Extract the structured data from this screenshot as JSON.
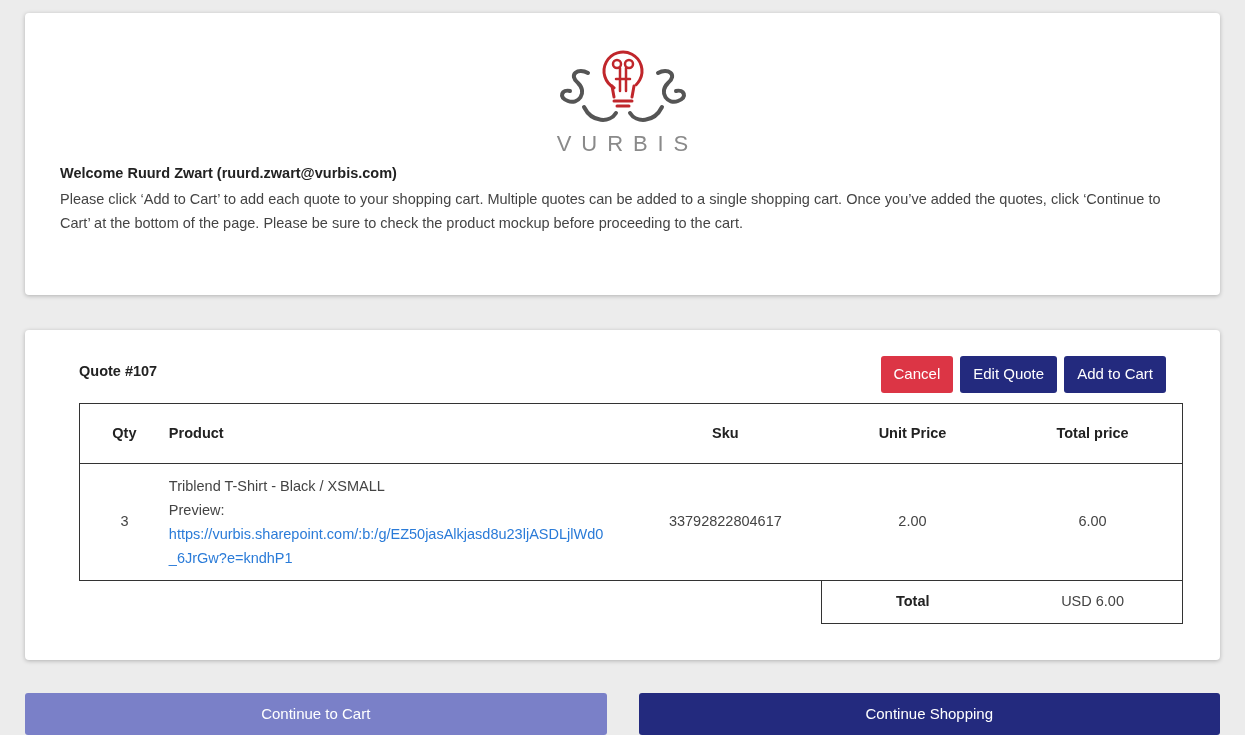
{
  "header": {
    "logo_text": "VURBIS",
    "welcome": "Welcome Ruurd Zwart (ruurd.zwart@vurbis.com)",
    "instructions": "Please click ‘Add to Cart’ to add each quote to your shopping cart. Multiple quotes can be added to a single shopping cart. Once you’ve added the quotes, click ‘Continue to Cart’ at the bottom of the page. Please be sure to check the product mockup before proceeding to the cart."
  },
  "quote": {
    "title": "Quote #107",
    "actions": [
      {
        "label": "Cancel",
        "kind": "danger"
      },
      {
        "label": "Edit Quote",
        "kind": "primary"
      },
      {
        "label": "Add to Cart",
        "kind": "primary"
      }
    ],
    "table": {
      "columns": [
        "Qty",
        "Product",
        "Sku",
        "Unit Price",
        "Total price"
      ],
      "rows": [
        {
          "qty": "3",
          "product": "Triblend T-Shirt - Black / XSMALL",
          "preview_label": "Preview:",
          "preview_link": "https://vurbis.sharepoint.com/:b:/g/EZ50jasAlkjasd8u23ljASDLjlWd0_6JrGw?e=kndhP1",
          "sku": "33792822804617",
          "unit_price": "2.00",
          "total_price": "6.00"
        }
      ],
      "total": {
        "label": "Total",
        "value": "USD 6.00"
      }
    }
  },
  "footer_buttons": [
    {
      "label": "Continue to Cart",
      "disabled": true
    },
    {
      "label": "Continue Shopping",
      "disabled": false
    }
  ]
}
